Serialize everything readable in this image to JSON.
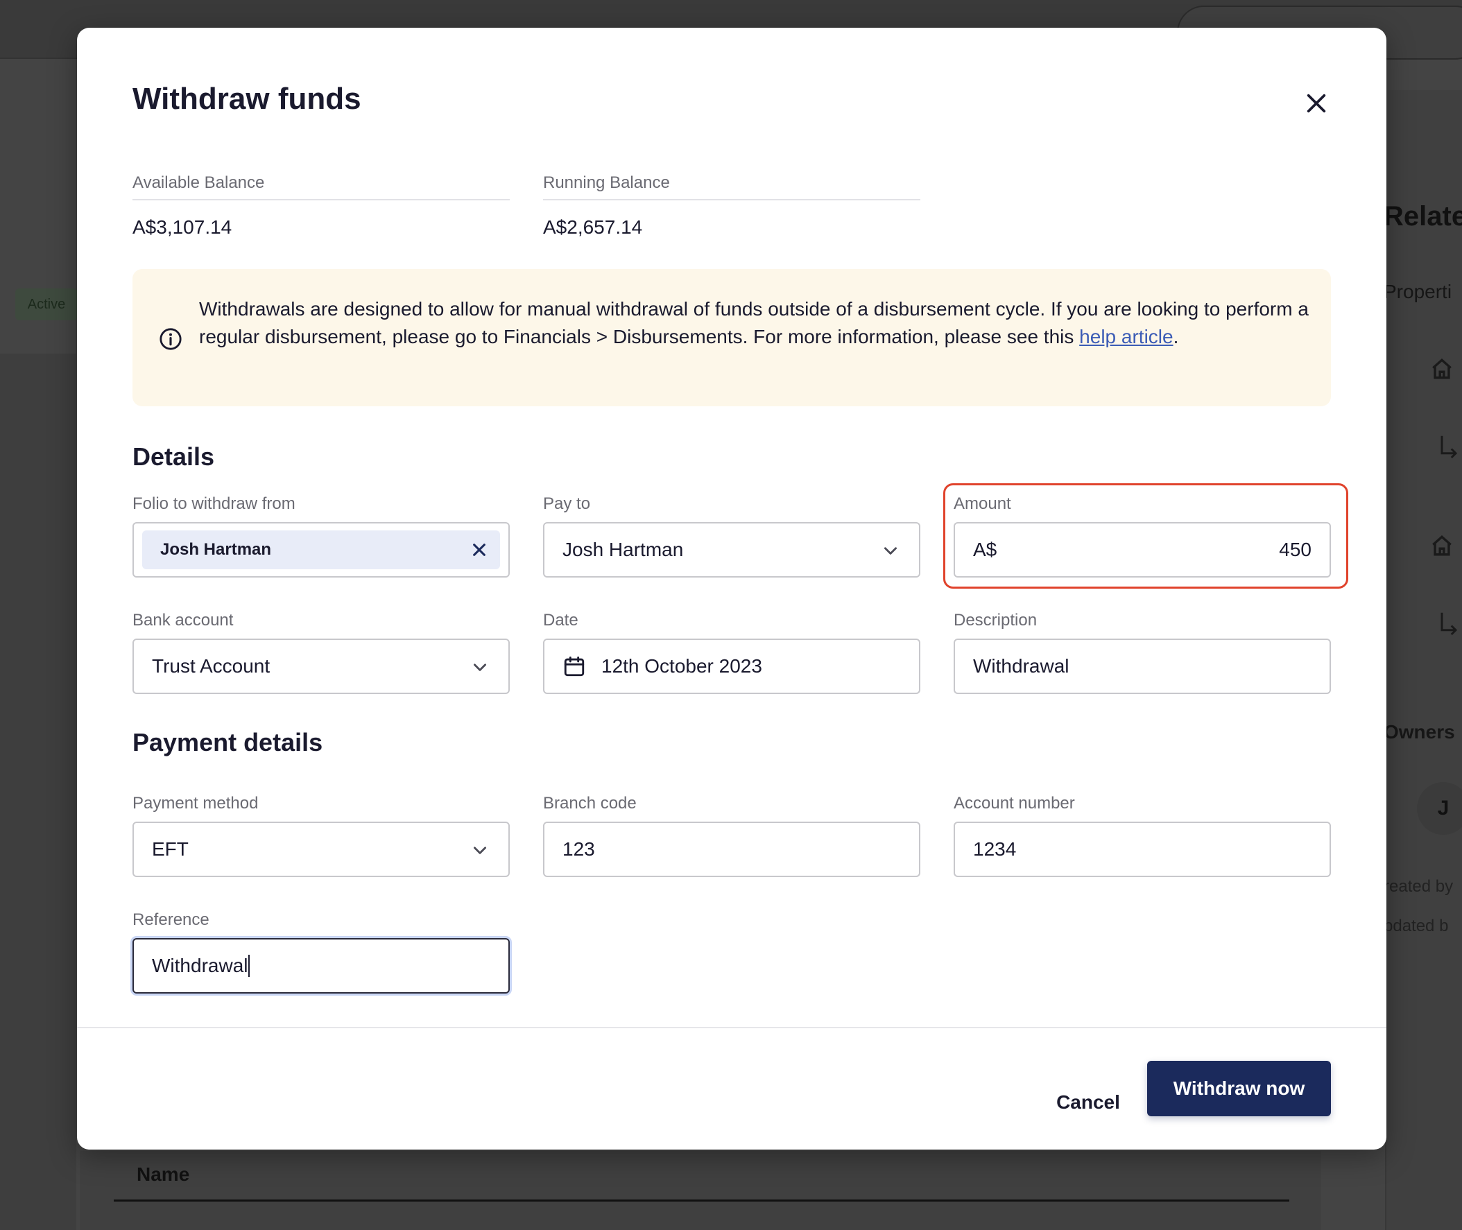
{
  "background": {
    "related_heading": "Relate",
    "properties_label": "Properti",
    "owners_label": "Owners",
    "created_label": "reated by",
    "updated_label": "pdated b",
    "avatar_initial": "J",
    "status_badge": "Active",
    "table_header_name": "Name"
  },
  "modal": {
    "title": "Withdraw funds",
    "balances": {
      "available_label": "Available Balance",
      "available_value": "A$3,107.14",
      "running_label": "Running Balance",
      "running_value": "A$2,657.14"
    },
    "info": {
      "text_before_link": "Withdrawals are designed to allow for manual withdrawal of funds outside of a disbursement cycle. If you are looking to perform a regular disbursement, please go to Financials > Disbursements. For more information, please see this ",
      "link_text": "help article",
      "text_after_link": "."
    },
    "details": {
      "heading": "Details",
      "folio_label": "Folio to withdraw from",
      "folio_value": "Josh Hartman",
      "pay_to_label": "Pay to",
      "pay_to_value": "Josh Hartman",
      "amount_label": "Amount",
      "amount_prefix": "A$",
      "amount_value": "450",
      "bank_label": "Bank account",
      "bank_value": "Trust Account",
      "date_label": "Date",
      "date_value": "12th October 2023",
      "description_label": "Description",
      "description_value": "Withdrawal"
    },
    "payment": {
      "heading": "Payment details",
      "method_label": "Payment method",
      "method_value": "EFT",
      "branch_label": "Branch code",
      "branch_value": "123",
      "account_label": "Account number",
      "account_value": "1234",
      "reference_label": "Reference",
      "reference_value": "Withdrawal"
    },
    "footer": {
      "cancel_label": "Cancel",
      "submit_label": "Withdraw now"
    }
  },
  "colors": {
    "primary": "#1b2a5c",
    "highlight": "#e0432c",
    "info_bg": "#fdf7e9",
    "link": "#3b5bb5"
  }
}
